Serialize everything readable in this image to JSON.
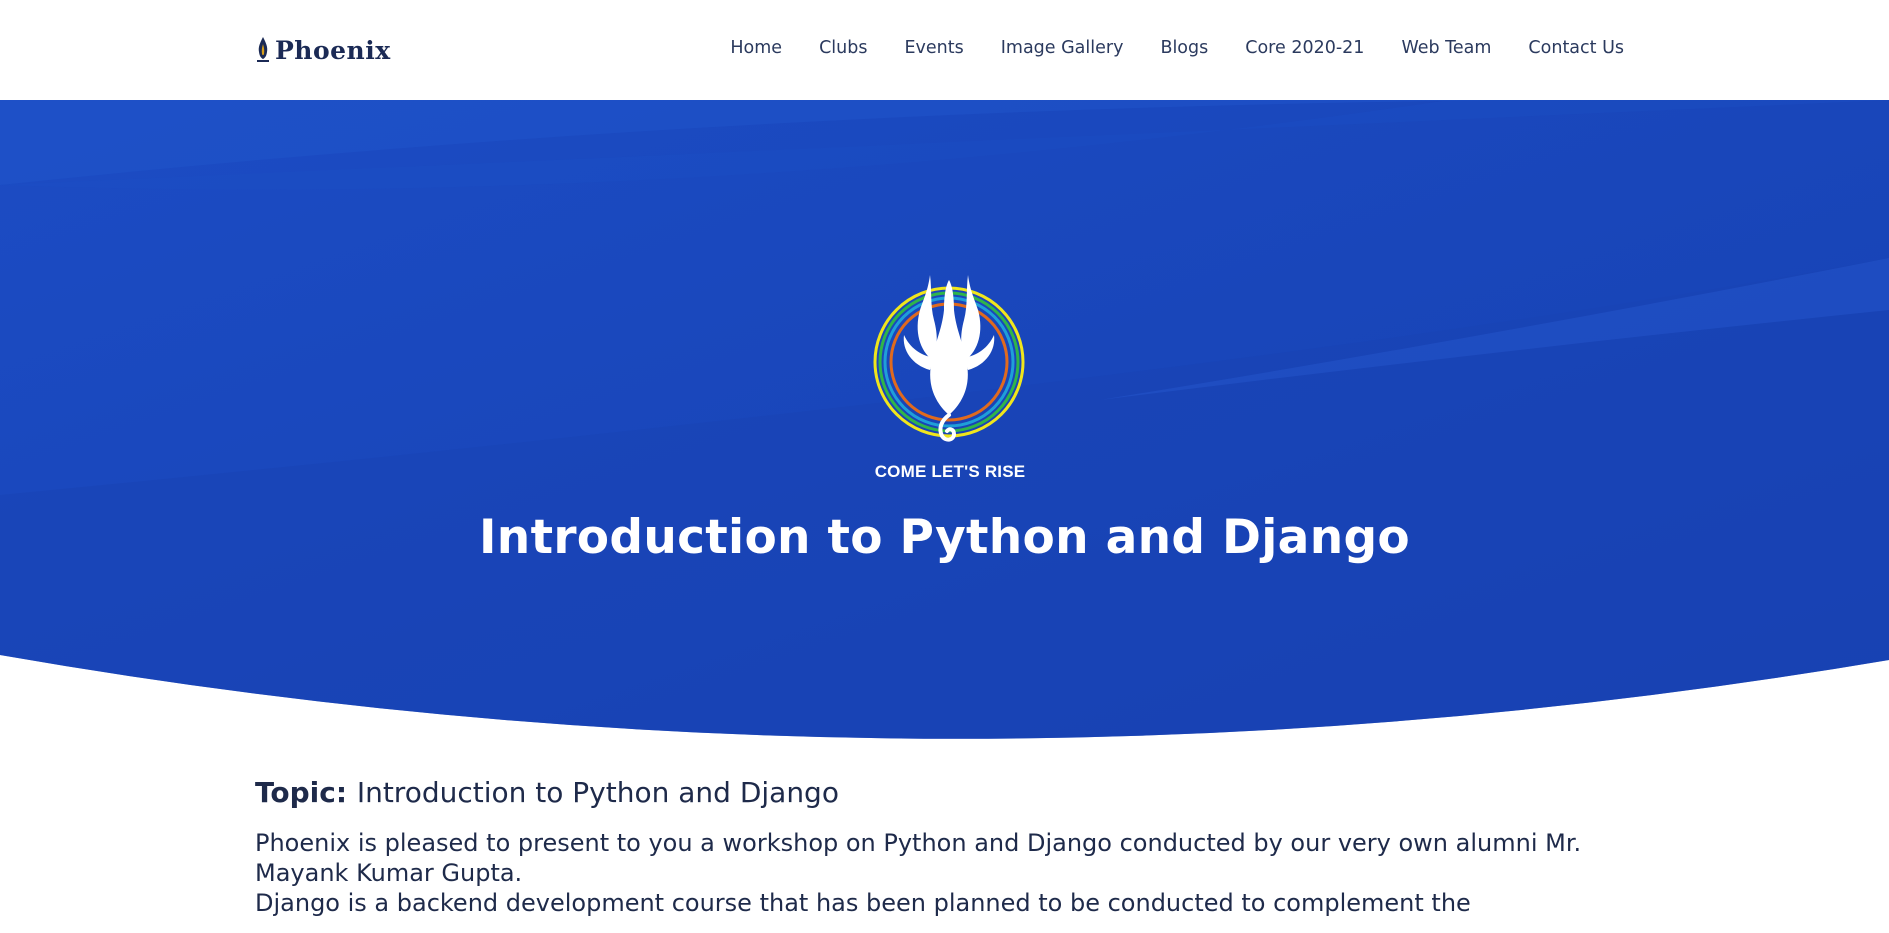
{
  "brand": {
    "name": "Phoenix",
    "icon": "phoenix-flame-icon"
  },
  "nav": {
    "items": [
      {
        "label": "Home"
      },
      {
        "label": "Clubs"
      },
      {
        "label": "Events"
      },
      {
        "label": "Image Gallery"
      },
      {
        "label": "Blogs"
      },
      {
        "label": "Core 2020-21"
      },
      {
        "label": "Web Team"
      },
      {
        "label": "Contact Us"
      }
    ]
  },
  "hero": {
    "tagline": "COME LET'S RISE",
    "title": "Introduction to Python and Django",
    "logo_icon": "phoenix-emblem-icon"
  },
  "content": {
    "topic_label": "Topic:",
    "topic_value": "Introduction to Python and Django",
    "paragraphs": [
      "Phoenix is pleased to present to you a workshop on Python and Django conducted by our very own alumni Mr. Mayank Kumar Gupta.",
      "Django is a backend development course that has been planned to be conducted to complement the"
    ]
  },
  "colors": {
    "hero_blue": "#1a44b8",
    "hero_blue_light": "#1f52c8",
    "text_dark": "#1e2a4a",
    "nav_text": "#2b3a5e"
  }
}
